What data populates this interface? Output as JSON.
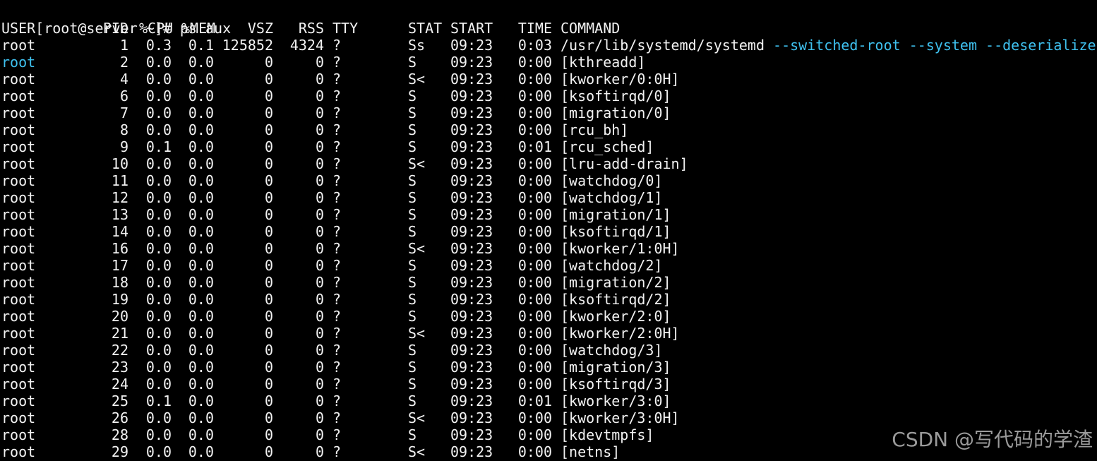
{
  "prompt": {
    "text": "[root@server ~]# ps aux"
  },
  "header": {
    "user": "USER",
    "pid": "PID",
    "cpu": "%CPU",
    "mem": "%MEM",
    "vsz": "VSZ",
    "rss": "RSS",
    "tty": "TTY",
    "stat": "STAT",
    "start": "START",
    "time": "TIME",
    "command": "COMMAND"
  },
  "rows": [
    {
      "user": "root",
      "pid": "1",
      "cpu": "0.3",
      "mem": "0.1",
      "vsz": "125852",
      "rss": "4324",
      "tty": "?",
      "stat": "Ss",
      "start": "09:23",
      "time": "0:03",
      "command": "/usr/lib/systemd/systemd",
      "args": "--switched-root --system --deserialize"
    },
    {
      "user": "root",
      "pid": "2",
      "cpu": "0.0",
      "mem": "0.0",
      "vsz": "0",
      "rss": "0",
      "tty": "?",
      "stat": "S",
      "start": "09:23",
      "time": "0:00",
      "command": "[kthreadd]",
      "user_highlight": true
    },
    {
      "user": "root",
      "pid": "4",
      "cpu": "0.0",
      "mem": "0.0",
      "vsz": "0",
      "rss": "0",
      "tty": "?",
      "stat": "S<",
      "start": "09:23",
      "time": "0:00",
      "command": "[kworker/0:0H]"
    },
    {
      "user": "root",
      "pid": "6",
      "cpu": "0.0",
      "mem": "0.0",
      "vsz": "0",
      "rss": "0",
      "tty": "?",
      "stat": "S",
      "start": "09:23",
      "time": "0:00",
      "command": "[ksoftirqd/0]"
    },
    {
      "user": "root",
      "pid": "7",
      "cpu": "0.0",
      "mem": "0.0",
      "vsz": "0",
      "rss": "0",
      "tty": "?",
      "stat": "S",
      "start": "09:23",
      "time": "0:00",
      "command": "[migration/0]"
    },
    {
      "user": "root",
      "pid": "8",
      "cpu": "0.0",
      "mem": "0.0",
      "vsz": "0",
      "rss": "0",
      "tty": "?",
      "stat": "S",
      "start": "09:23",
      "time": "0:00",
      "command": "[rcu_bh]"
    },
    {
      "user": "root",
      "pid": "9",
      "cpu": "0.1",
      "mem": "0.0",
      "vsz": "0",
      "rss": "0",
      "tty": "?",
      "stat": "S",
      "start": "09:23",
      "time": "0:01",
      "command": "[rcu_sched]"
    },
    {
      "user": "root",
      "pid": "10",
      "cpu": "0.0",
      "mem": "0.0",
      "vsz": "0",
      "rss": "0",
      "tty": "?",
      "stat": "S<",
      "start": "09:23",
      "time": "0:00",
      "command": "[lru-add-drain]"
    },
    {
      "user": "root",
      "pid": "11",
      "cpu": "0.0",
      "mem": "0.0",
      "vsz": "0",
      "rss": "0",
      "tty": "?",
      "stat": "S",
      "start": "09:23",
      "time": "0:00",
      "command": "[watchdog/0]"
    },
    {
      "user": "root",
      "pid": "12",
      "cpu": "0.0",
      "mem": "0.0",
      "vsz": "0",
      "rss": "0",
      "tty": "?",
      "stat": "S",
      "start": "09:23",
      "time": "0:00",
      "command": "[watchdog/1]"
    },
    {
      "user": "root",
      "pid": "13",
      "cpu": "0.0",
      "mem": "0.0",
      "vsz": "0",
      "rss": "0",
      "tty": "?",
      "stat": "S",
      "start": "09:23",
      "time": "0:00",
      "command": "[migration/1]"
    },
    {
      "user": "root",
      "pid": "14",
      "cpu": "0.0",
      "mem": "0.0",
      "vsz": "0",
      "rss": "0",
      "tty": "?",
      "stat": "S",
      "start": "09:23",
      "time": "0:00",
      "command": "[ksoftirqd/1]"
    },
    {
      "user": "root",
      "pid": "16",
      "cpu": "0.0",
      "mem": "0.0",
      "vsz": "0",
      "rss": "0",
      "tty": "?",
      "stat": "S<",
      "start": "09:23",
      "time": "0:00",
      "command": "[kworker/1:0H]"
    },
    {
      "user": "root",
      "pid": "17",
      "cpu": "0.0",
      "mem": "0.0",
      "vsz": "0",
      "rss": "0",
      "tty": "?",
      "stat": "S",
      "start": "09:23",
      "time": "0:00",
      "command": "[watchdog/2]"
    },
    {
      "user": "root",
      "pid": "18",
      "cpu": "0.0",
      "mem": "0.0",
      "vsz": "0",
      "rss": "0",
      "tty": "?",
      "stat": "S",
      "start": "09:23",
      "time": "0:00",
      "command": "[migration/2]"
    },
    {
      "user": "root",
      "pid": "19",
      "cpu": "0.0",
      "mem": "0.0",
      "vsz": "0",
      "rss": "0",
      "tty": "?",
      "stat": "S",
      "start": "09:23",
      "time": "0:00",
      "command": "[ksoftirqd/2]"
    },
    {
      "user": "root",
      "pid": "20",
      "cpu": "0.0",
      "mem": "0.0",
      "vsz": "0",
      "rss": "0",
      "tty": "?",
      "stat": "S",
      "start": "09:23",
      "time": "0:00",
      "command": "[kworker/2:0]"
    },
    {
      "user": "root",
      "pid": "21",
      "cpu": "0.0",
      "mem": "0.0",
      "vsz": "0",
      "rss": "0",
      "tty": "?",
      "stat": "S<",
      "start": "09:23",
      "time": "0:00",
      "command": "[kworker/2:0H]"
    },
    {
      "user": "root",
      "pid": "22",
      "cpu": "0.0",
      "mem": "0.0",
      "vsz": "0",
      "rss": "0",
      "tty": "?",
      "stat": "S",
      "start": "09:23",
      "time": "0:00",
      "command": "[watchdog/3]"
    },
    {
      "user": "root",
      "pid": "23",
      "cpu": "0.0",
      "mem": "0.0",
      "vsz": "0",
      "rss": "0",
      "tty": "?",
      "stat": "S",
      "start": "09:23",
      "time": "0:00",
      "command": "[migration/3]"
    },
    {
      "user": "root",
      "pid": "24",
      "cpu": "0.0",
      "mem": "0.0",
      "vsz": "0",
      "rss": "0",
      "tty": "?",
      "stat": "S",
      "start": "09:23",
      "time": "0:00",
      "command": "[ksoftirqd/3]"
    },
    {
      "user": "root",
      "pid": "25",
      "cpu": "0.1",
      "mem": "0.0",
      "vsz": "0",
      "rss": "0",
      "tty": "?",
      "stat": "S",
      "start": "09:23",
      "time": "0:01",
      "command": "[kworker/3:0]"
    },
    {
      "user": "root",
      "pid": "26",
      "cpu": "0.0",
      "mem": "0.0",
      "vsz": "0",
      "rss": "0",
      "tty": "?",
      "stat": "S<",
      "start": "09:23",
      "time": "0:00",
      "command": "[kworker/3:0H]"
    },
    {
      "user": "root",
      "pid": "28",
      "cpu": "0.0",
      "mem": "0.0",
      "vsz": "0",
      "rss": "0",
      "tty": "?",
      "stat": "S",
      "start": "09:23",
      "time": "0:00",
      "command": "[kdevtmpfs]"
    },
    {
      "user": "root",
      "pid": "29",
      "cpu": "0.0",
      "mem": "0.0",
      "vsz": "0",
      "rss": "0",
      "tty": "?",
      "stat": "S<",
      "start": "09:23",
      "time": "0:00",
      "command": "[netns]"
    }
  ],
  "watermark": "CSDN @写代码的学渣",
  "colors": {
    "background": "#000000",
    "foreground": "#f2f2f2",
    "highlight": "#3fc1ef",
    "watermark": "#9a9a9a"
  }
}
